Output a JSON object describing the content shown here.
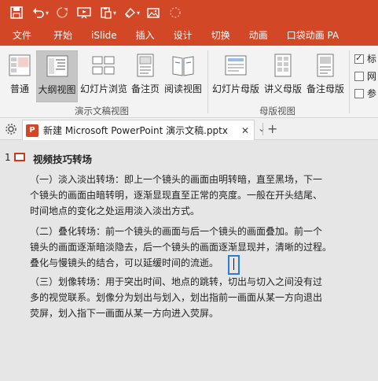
{
  "quick_access": {
    "icons": [
      "save-icon",
      "undo-icon",
      "redo-icon",
      "slideshow-icon",
      "paste-icon",
      "format-icon",
      "picture-icon",
      "shape-icon"
    ]
  },
  "ribbon_tabs": [
    "文件",
    "开始",
    "iSlide",
    "插入",
    "设计",
    "切换",
    "动画",
    "口袋动画 PA"
  ],
  "ribbon": {
    "buttons": [
      {
        "label": "普通",
        "icon": "normal-view-icon"
      },
      {
        "label": "大纲视图",
        "icon": "outline-view-icon"
      },
      {
        "label": "幻灯片浏览",
        "icon": "slide-sorter-icon"
      },
      {
        "label": "备注页",
        "icon": "notes-page-icon"
      },
      {
        "label": "阅读视图",
        "icon": "reading-view-icon"
      },
      {
        "label": "幻灯片母版",
        "icon": "slide-master-icon"
      },
      {
        "label": "讲义母版",
        "icon": "handout-master-icon"
      },
      {
        "label": "备注母版",
        "icon": "notes-master-icon"
      }
    ],
    "groups": [
      "演示文稿视图",
      "母版视图"
    ],
    "checkboxes": [
      {
        "label": "标",
        "checked": true
      },
      {
        "label": "网",
        "checked": false
      },
      {
        "label": "参",
        "checked": false
      }
    ]
  },
  "document_tab": {
    "icon_label": "P",
    "title": "新建 Microsoft PowerPoint 演示文稿.pptx",
    "close": "✕",
    "dropdown": "⌄",
    "new": "+"
  },
  "outline": {
    "slide_number": "1",
    "title": "视频技巧转场",
    "paragraphs": [
      [
        "（一）淡入淡出转场：即上一个镜头的画面由明转暗，直至黑场，下一",
        "个镜头的画面由暗转明，逐渐显现直至正常的亮度。一般在开头结尾、",
        "时间地点的变化之处运用淡入淡出方式。"
      ],
      [
        "（二）叠化转场：前一个镜头的画面与后一个镜头的画面叠加。前一个",
        "镜头的画面逐渐暗淡隐去，后一个镜头的画面逐渐显现并，清晰的过程。",
        "叠化与慢镜头的结合，可以延缓时间的流逝。"
      ],
      [
        "（三）划像转场：用于突出时间、地点的跳转，切出与切入之间没有过",
        "多的视觉联系。划像分为划出与划入，划出指前一画面从某一方向退出",
        "荧屏，划入指下一画面从某一方向进入荧屏。"
      ]
    ]
  },
  "colors": {
    "accent": "#d24726",
    "ribbon_bg": "#f3f3f3",
    "pane_bg": "#e6e6e6",
    "cursor_box": "#2b7cd3"
  }
}
